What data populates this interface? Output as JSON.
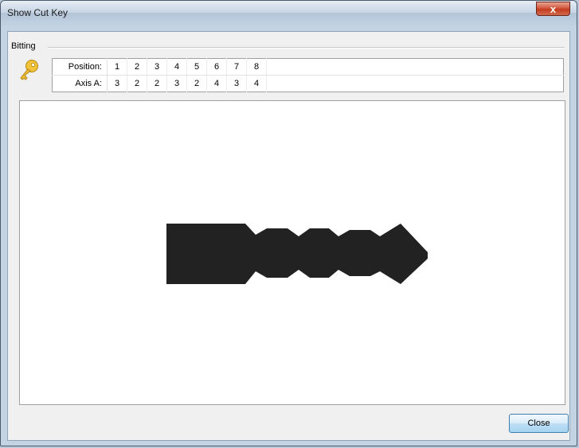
{
  "window": {
    "title": "Show Cut Key",
    "close_glyph": "x"
  },
  "bitting": {
    "group_label": "Bitting",
    "icon": "key-icon",
    "position_label": "Position:",
    "positions": [
      "1",
      "2",
      "3",
      "4",
      "5",
      "6",
      "7",
      "8"
    ],
    "axis_label": "Axis A:",
    "axis_a": [
      "3",
      "2",
      "2",
      "3",
      "2",
      "4",
      "3",
      "4"
    ]
  },
  "footer": {
    "close_label": "Close"
  },
  "colors": {
    "key_fill": "#222222",
    "close_accent": "#c23b1e",
    "button_border": "#3c7fb1"
  }
}
